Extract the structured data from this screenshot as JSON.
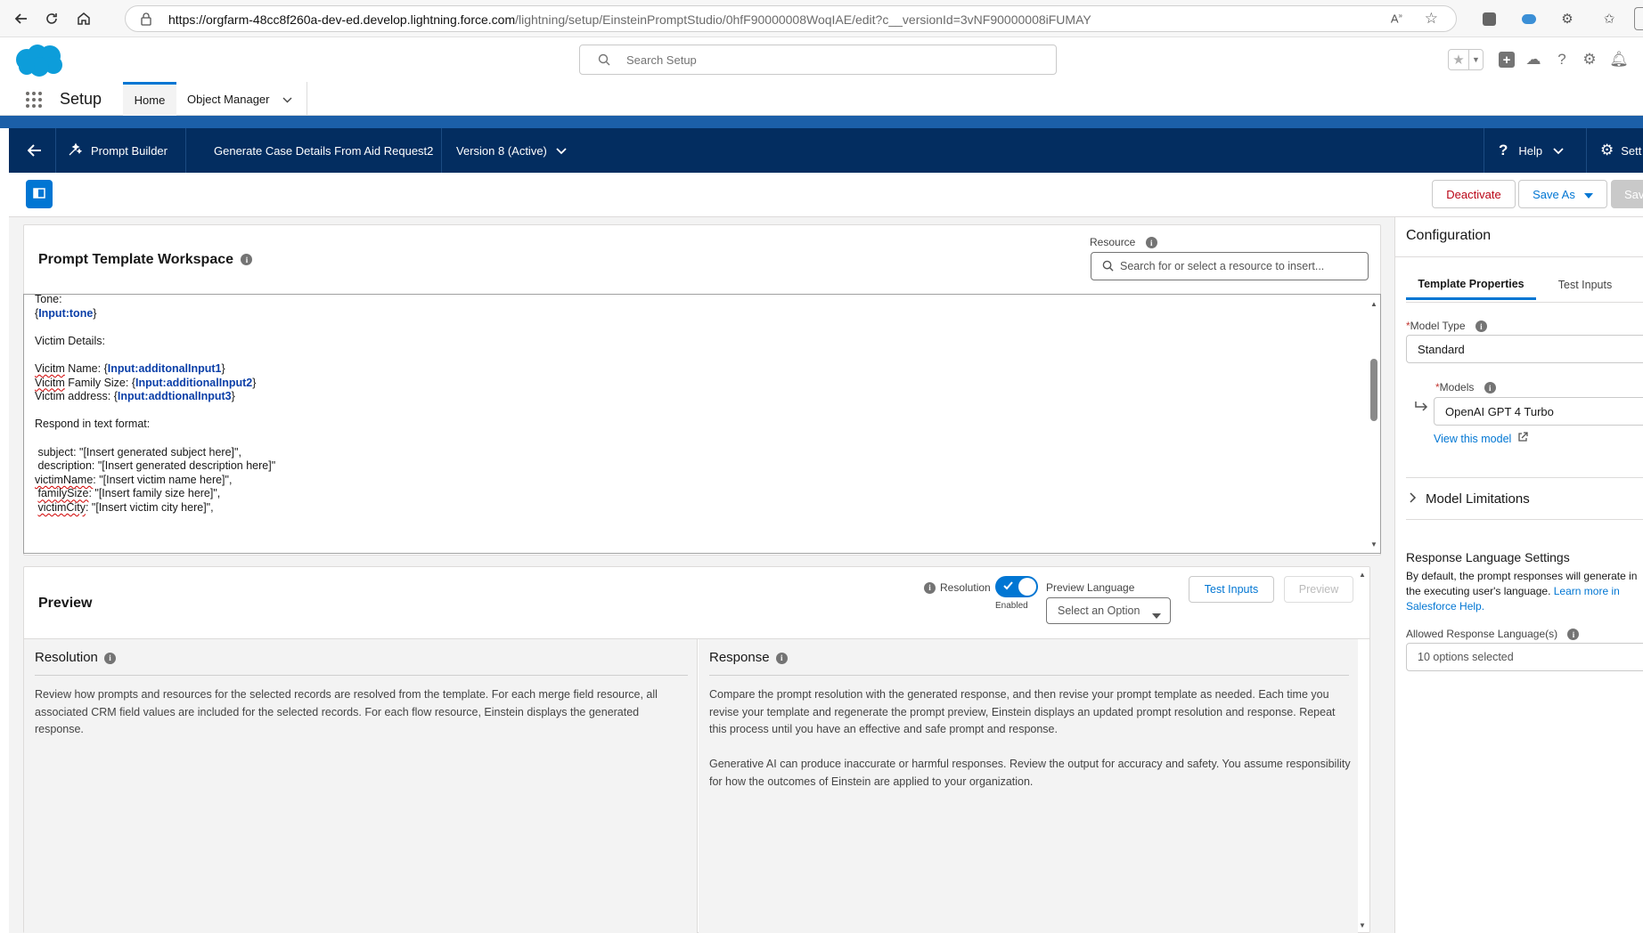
{
  "browser": {
    "url_host": "https://orgfarm-48cc8f260a-dev-ed.develop.lightning.force.com",
    "url_path": "/lightning/setup/EinsteinPromptStudio/0hfF90000008WoqIAE/edit?c__versionId=3vNF90000008iFUMAY"
  },
  "header": {
    "search_placeholder": "Search Setup"
  },
  "setup_nav": {
    "app_name": "Setup",
    "tab_home": "Home",
    "tab_object_manager": "Object Manager"
  },
  "builder": {
    "app_label": "Prompt Builder",
    "template_name": "Generate Case Details From Aid Request2",
    "version": "Version 8 (Active)",
    "help": "Help",
    "settings_partial": "Sett"
  },
  "actions": {
    "deactivate": "Deactivate",
    "save_as": "Save As",
    "save_partial": "Sav"
  },
  "workspace": {
    "title": "Prompt Template Workspace",
    "resource_label": "Resource",
    "resource_placeholder": "Search for or select a resource to insert...",
    "lines": [
      {
        "pre": "Tone:",
        "merge": "",
        "post": ""
      },
      {
        "pre": "{",
        "merge": "Input:tone",
        "post": "}"
      },
      {
        "pre": "",
        "merge": "",
        "post": ""
      },
      {
        "pre": "Victim Details:",
        "merge": "",
        "post": ""
      },
      {
        "pre": "",
        "merge": "",
        "post": ""
      },
      {
        "pre": "Vicitm Name: {",
        "merge": "Input:additonalInput1",
        "post": "}"
      },
      {
        "pre": "Vicitm Family Size: {",
        "merge": "Input:additionalInput2",
        "post": "}"
      },
      {
        "pre": "Victim address: {",
        "merge": "Input:addtionalInput3",
        "post": "}"
      },
      {
        "pre": "",
        "merge": "",
        "post": ""
      },
      {
        "pre": "Respond in text format:",
        "merge": "",
        "post": ""
      },
      {
        "pre": "",
        "merge": "",
        "post": ""
      },
      {
        "pre": " subject: \"[Insert generated subject here]\",",
        "merge": "",
        "post": ""
      },
      {
        "pre": " description: \"[Insert generated description here]\"",
        "merge": "",
        "post": ""
      },
      {
        "pre": "victimName: \"[Insert victim name here]\",",
        "merge": "",
        "post": ""
      },
      {
        "pre": " familySize: \"[Insert family size here]\",",
        "merge": "",
        "post": ""
      },
      {
        "pre": " victimCity: \"[Insert victim city here]\",",
        "merge": "",
        "post": ""
      }
    ]
  },
  "preview": {
    "title": "Preview",
    "resolution_label": "Resolution",
    "toggle_state": "Enabled",
    "preview_language_label": "Preview Language",
    "select_placeholder": "Select an Option",
    "test_inputs_button": "Test Inputs",
    "preview_button": "Preview",
    "resolution_heading": "Resolution",
    "resolution_text": "Review how prompts and resources for the selected records are resolved from the template. For each merge field resource, all associated CRM field values are included for the selected records. For each flow resource, Einstein displays the generated response.",
    "response_heading": "Response",
    "response_text_1": "Compare the prompt resolution with the generated response, and then revise your prompt template as needed. Each time you revise your template and regenerate the prompt preview, Einstein displays an updated prompt resolution and response. Repeat this process until you have an effective and safe prompt and response.",
    "response_text_2": "Generative AI can produce inaccurate or harmful responses. Review the output for accuracy and safety. You assume responsibility for how the outcomes of Einstein are applied to your organization."
  },
  "config": {
    "title": "Configuration",
    "tab_properties": "Template Properties",
    "tab_test_inputs": "Test Inputs",
    "model_type_label": "Model Type",
    "model_type_value": "Standard",
    "models_label": "Models",
    "models_value": "OpenAI GPT 4 Turbo",
    "view_model_link": "View this model",
    "model_limitations": "Model Limitations",
    "response_lang_heading": "Response Language Settings",
    "response_lang_text": "By default, the prompt responses will generate in the executing user's language.",
    "learn_more": "Learn more in Salesforce Help.",
    "allowed_lang_label": "Allowed Response Language(s)",
    "allowed_lang_value": "10 options selected"
  },
  "colors": {
    "brand_blue": "#0176d3",
    "nav_dark": "#032d60",
    "merge_field": "#0b3fa8",
    "deactivate": "#ba0517"
  }
}
